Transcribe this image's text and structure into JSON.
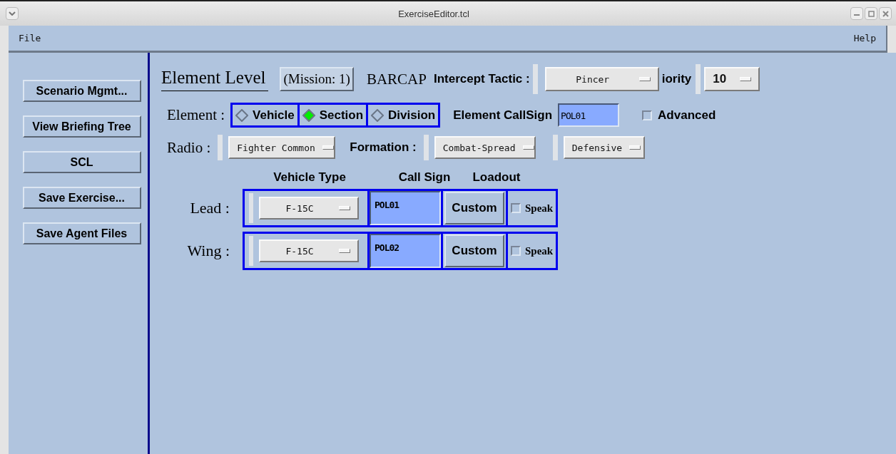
{
  "window": {
    "title": "ExerciseEditor.tcl"
  },
  "menu": {
    "left": "File",
    "right": "Help"
  },
  "sidebar": {
    "buttons": [
      "Scenario Mgmt...",
      "View Briefing Tree",
      "SCL",
      "Save Exercise...",
      "Save Agent Files"
    ]
  },
  "header": {
    "title": "Element Level",
    "mission_button": "(Mission: 1)",
    "mission_type": "BARCAP",
    "intercept_label": "Intercept Tactic :",
    "intercept_value": "Pincer",
    "priority_label": "iority",
    "priority_value": "10"
  },
  "element": {
    "label": "Element :",
    "options": [
      {
        "label": "Vehicle",
        "selected": false
      },
      {
        "label": "Section",
        "selected": true
      },
      {
        "label": "Division",
        "selected": false
      }
    ],
    "callsign_label": "Element CallSign",
    "callsign_value": "POL01",
    "advanced": {
      "label": "Advanced",
      "checked": false
    }
  },
  "radio": {
    "label": "Radio :",
    "value": "Fighter Common",
    "formation_label": "Formation :",
    "formation_value": "Combat-Spread",
    "posture_value": "Defensive"
  },
  "columns": [
    "Vehicle Type",
    "Call Sign",
    "Loadout"
  ],
  "vehicles": [
    {
      "role": "Lead :",
      "type": "F-15C",
      "callsign": "POL01",
      "loadout": "Custom",
      "speak": {
        "label": "Speak",
        "checked": false
      }
    },
    {
      "role": "Wing :",
      "type": "F-15C",
      "callsign": "POL02",
      "loadout": "Custom",
      "speak": {
        "label": "Speak",
        "checked": false
      }
    }
  ]
}
